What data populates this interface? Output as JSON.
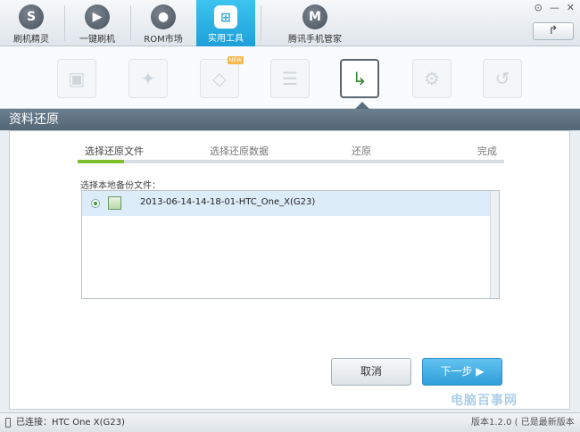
{
  "window": {
    "controls": [
      "⊙",
      "—",
      "✕"
    ],
    "refresh_icon": "↱"
  },
  "nav": [
    {
      "label": "刷机精灵",
      "icon": "S"
    },
    {
      "label": "一键刷机",
      "icon": "▶"
    },
    {
      "label": "ROM市场",
      "icon": "●"
    },
    {
      "label": "实用工具",
      "icon": "⊞",
      "active": true
    },
    {
      "label": "腾讯手机管家",
      "icon": "M"
    }
  ],
  "tools": [
    {
      "icon": "▣"
    },
    {
      "icon": "✦"
    },
    {
      "icon": "◇",
      "badge": "NEW"
    },
    {
      "icon": "☰"
    },
    {
      "icon": "↳",
      "active": true
    },
    {
      "icon": "⚙"
    },
    {
      "icon": "↺"
    }
  ],
  "page_title": "资料还原",
  "steps": [
    {
      "label": "选择还原文件"
    },
    {
      "label": "选择还原数据"
    },
    {
      "label": "还原"
    },
    {
      "label": "完成"
    }
  ],
  "list": {
    "label": "选择本地备份文件：",
    "files": [
      {
        "name": "2013-06-14-14-18-01-HTC_One_X(G23)",
        "selected": true
      }
    ]
  },
  "buttons": {
    "cancel": "取消",
    "next": "下一步 ▶"
  },
  "status": {
    "connected": "已连接：HTC One X(G23)",
    "version": "版本1.2.0 ( 已是最新版本 )"
  },
  "watermark": "电脑百事网",
  "colors": {
    "accent": "#2aa5dc",
    "progress": "#7bbf2d",
    "title_band": "#5d7181"
  }
}
